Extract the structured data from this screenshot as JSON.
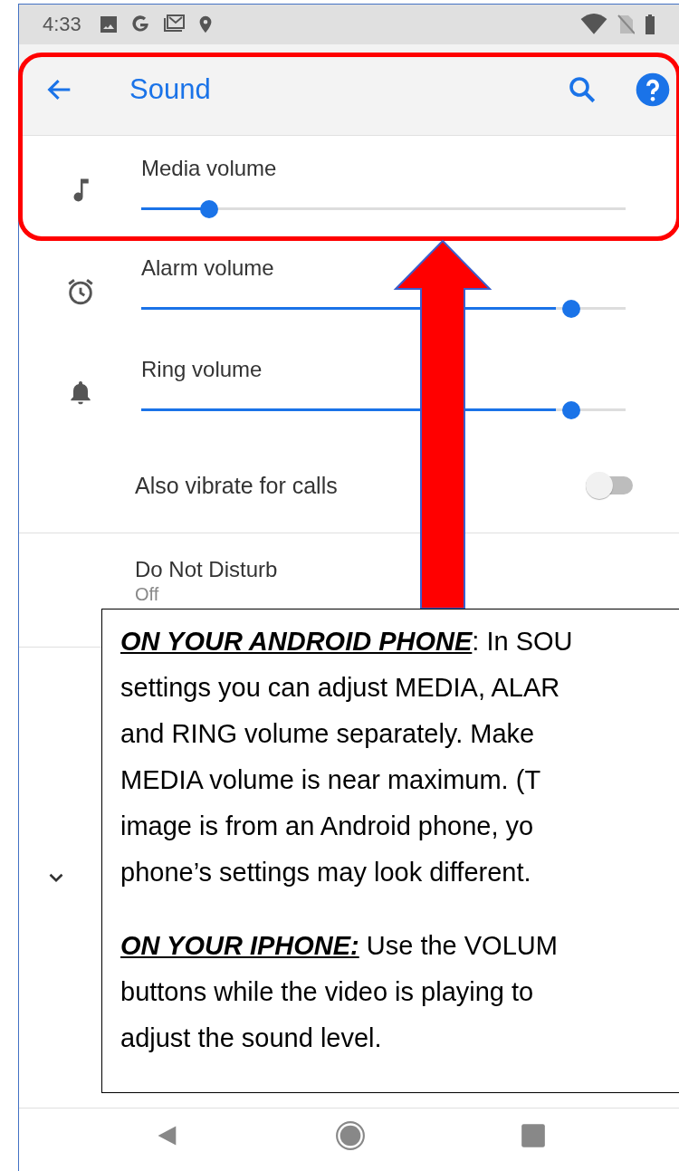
{
  "status_bar": {
    "time": "4:33"
  },
  "toolbar": {
    "title": "Sound"
  },
  "volumes": [
    {
      "kind": "media",
      "label": "Media volume",
      "level": 0.135
    },
    {
      "kind": "alarm",
      "label": "Alarm volume",
      "level": 0.856
    },
    {
      "kind": "ring",
      "label": "Ring volume",
      "level": 0.856
    }
  ],
  "vibrate": {
    "label": "Also vibrate for calls",
    "on": false
  },
  "do_not_disturb": {
    "title": "Do Not Disturb",
    "summary": "Off"
  },
  "callout": {
    "paragraphs": [
      {
        "lead": "ON YOUR ANDROID PHONE",
        "lines": [
          ": In SOU",
          "settings you can adjust MEDIA, ALAR",
          "and RING volume separately.  Make",
          "MEDIA volume is near maximum.  (T",
          "image is from an Android phone, yo",
          "phone’s settings may look different."
        ]
      },
      {
        "lead": "ON YOUR IPHONE:",
        "lines": [
          " Use the VOLUM",
          "buttons while the video is playing to",
          "adjust the sound level."
        ]
      }
    ]
  }
}
